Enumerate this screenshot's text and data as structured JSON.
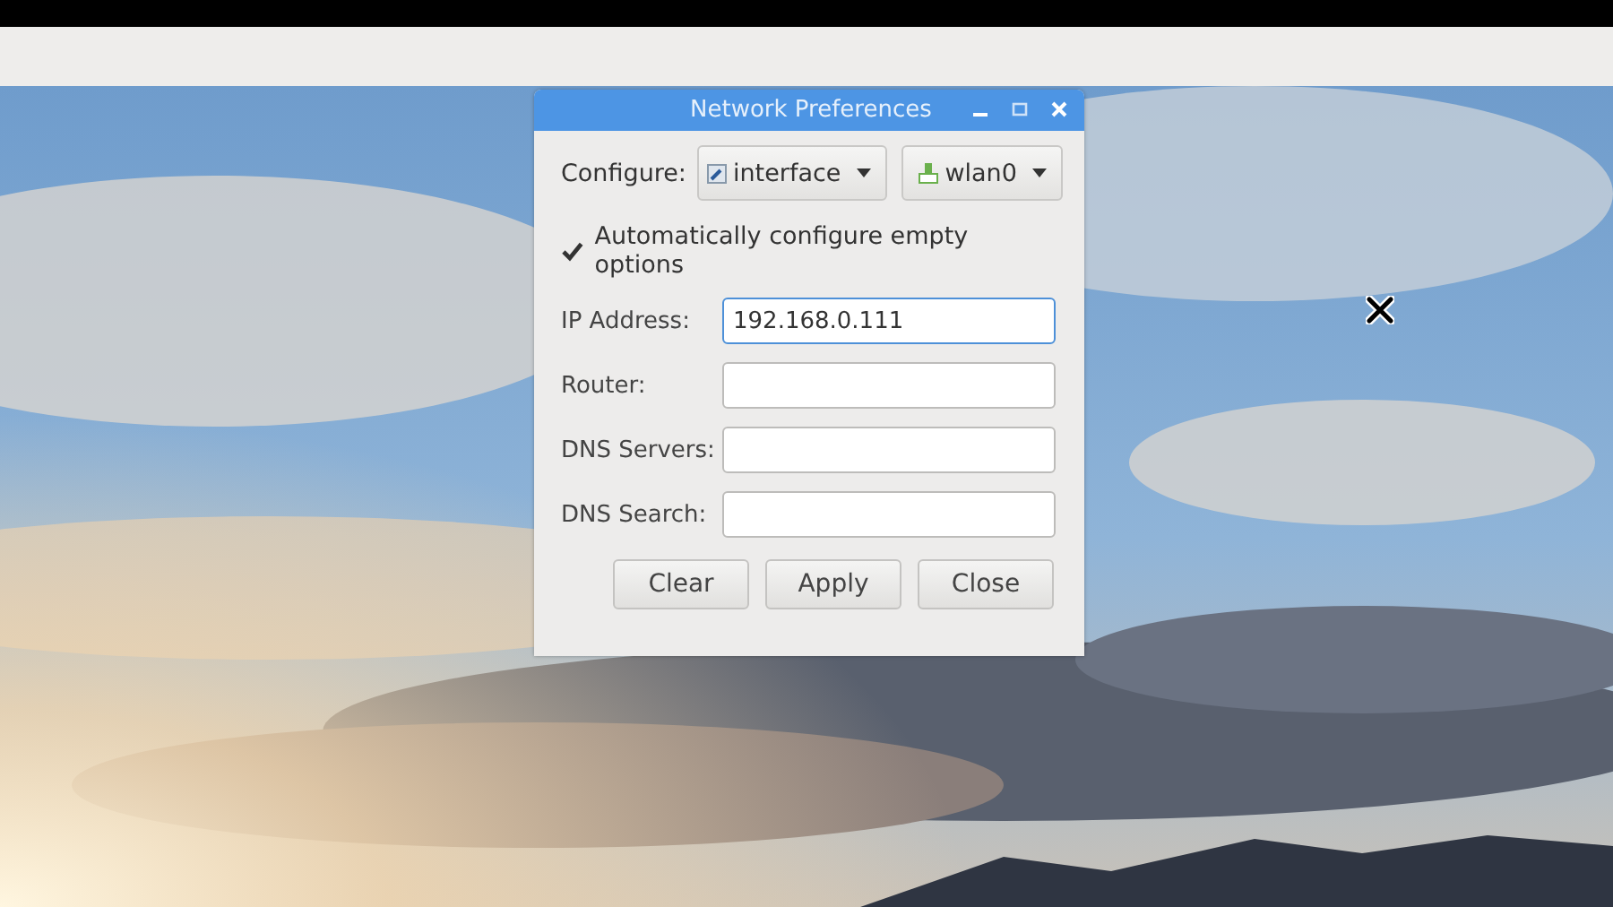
{
  "window": {
    "title": "Network Preferences"
  },
  "configure": {
    "label": "Configure:",
    "dropdowns": [
      {
        "kind": "interface",
        "value": "interface"
      },
      {
        "kind": "device",
        "value": "wlan0"
      }
    ]
  },
  "auto_configure": {
    "label": "Automatically configure empty options",
    "checked": true
  },
  "fields": [
    {
      "label": "IP Address:",
      "value": "192.168.0.111",
      "focused": true
    },
    {
      "label": "Router:",
      "focused": false
    },
    {
      "label": "DNS Servers:",
      "focused": false
    },
    {
      "label": "DNS Search:",
      "focused": false
    }
  ],
  "buttons": [
    "Clear",
    "Apply",
    "Close"
  ]
}
